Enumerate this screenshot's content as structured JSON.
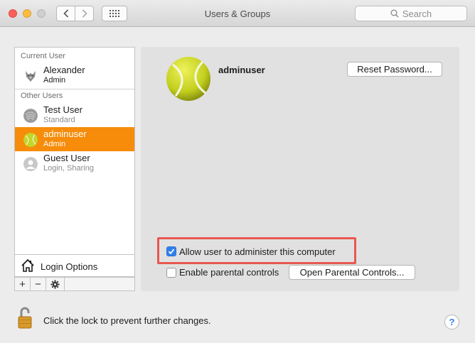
{
  "window": {
    "title": "Users & Groups"
  },
  "search": {
    "placeholder": "Search"
  },
  "sidebar": {
    "current_header": "Current User",
    "other_header": "Other Users",
    "users": [
      {
        "name": "Alexander",
        "role": "Admin",
        "avatar": "wolf-avatar-icon"
      },
      {
        "name": "Test User",
        "role": "Standard",
        "avatar": "fingerprint-avatar-icon"
      },
      {
        "name": "adminuser",
        "role": "Admin",
        "avatar": "tennis-ball-avatar-icon",
        "selected": true
      },
      {
        "name": "Guest User",
        "role": "Login, Sharing",
        "avatar": "guest-avatar-icon"
      }
    ],
    "login_options": "Login Options",
    "buttons": {
      "add": "+",
      "remove": "−"
    }
  },
  "detail": {
    "username": "adminuser",
    "reset_password": "Reset Password...",
    "allow_admin": {
      "label": "Allow user to administer this computer",
      "checked": true
    },
    "parental": {
      "label": "Enable parental controls",
      "checked": false
    },
    "open_parental": "Open Parental Controls..."
  },
  "footer": {
    "lock_text": "Click the lock to prevent further changes.",
    "help": "?"
  },
  "colors": {
    "selection": "#f68c0a",
    "highlight_box": "#e8584f",
    "checkbox_checked": "#2f80ed"
  }
}
